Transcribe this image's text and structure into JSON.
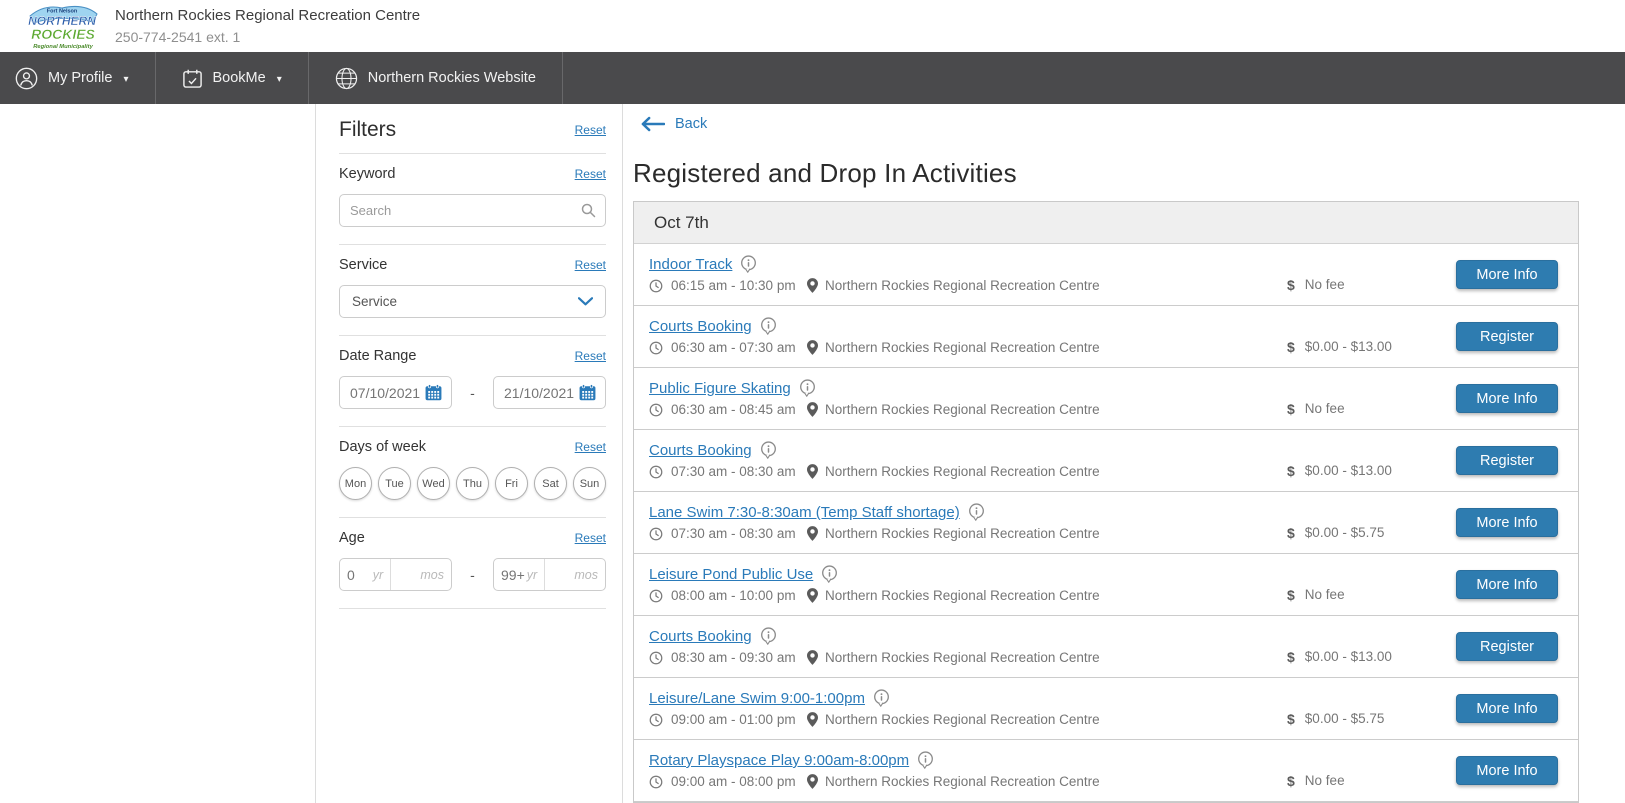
{
  "header": {
    "title": "Northern Rockies Regional Recreation Centre",
    "phone": "250-774-2541 ext. 1",
    "logo": {
      "top": "Fort Nelson",
      "line1": "NORTHERN",
      "line2": "ROCKIES",
      "bottom": "Regional Municipality"
    }
  },
  "nav": {
    "dropdown_caret": "▾",
    "items": [
      {
        "label": "My Profile",
        "icon": "person-icon",
        "has_dropdown": true
      },
      {
        "label": "BookMe",
        "icon": "calendar-check-icon",
        "has_dropdown": true
      },
      {
        "label": "Northern Rockies Website",
        "icon": "globe-icon",
        "has_dropdown": false
      }
    ]
  },
  "filters": {
    "title": "Filters",
    "reset_label": "Reset",
    "keyword": {
      "label": "Keyword",
      "placeholder": "Search"
    },
    "service": {
      "label": "Service",
      "selected_value": "Service"
    },
    "date_range": {
      "label": "Date Range",
      "from": "07/10/2021",
      "to": "21/10/2021",
      "separator": "-"
    },
    "days_of_week": {
      "label": "Days of week",
      "days": [
        "Mon",
        "Tue",
        "Wed",
        "Thu",
        "Fri",
        "Sat",
        "Sun"
      ]
    },
    "age": {
      "label": "Age",
      "separator": "-",
      "from": {
        "value": "0",
        "unit": "yr",
        "months_placeholder": "mos"
      },
      "to": {
        "value": "99+",
        "unit": "yr",
        "months_placeholder": "mos"
      }
    }
  },
  "main": {
    "back_label": "Back",
    "page_title": "Registered and Drop In Activities",
    "date_header": "Oct 7th",
    "fee_symbol": "$",
    "activities": [
      {
        "title": "Indoor Track",
        "time": "06:15 am - 10:30 pm",
        "location": "Northern Rockies Regional Recreation Centre",
        "fee": "No fee",
        "action": "More Info"
      },
      {
        "title": "Courts Booking",
        "time": "06:30 am - 07:30 am",
        "location": "Northern Rockies Regional Recreation Centre",
        "fee": "$0.00 - $13.00",
        "action": "Register"
      },
      {
        "title": "Public Figure Skating",
        "time": "06:30 am - 08:45 am",
        "location": "Northern Rockies Regional Recreation Centre",
        "fee": "No fee",
        "action": "More Info"
      },
      {
        "title": "Courts Booking",
        "time": "07:30 am - 08:30 am",
        "location": "Northern Rockies Regional Recreation Centre",
        "fee": "$0.00 - $13.00",
        "action": "Register"
      },
      {
        "title": "Lane Swim 7:30-8:30am (Temp Staff shortage)",
        "time": "07:30 am - 08:30 am",
        "location": "Northern Rockies Regional Recreation Centre",
        "fee": "$0.00 - $5.75",
        "action": "More Info"
      },
      {
        "title": "Leisure Pond Public Use",
        "time": "08:00 am - 10:00 pm",
        "location": "Northern Rockies Regional Recreation Centre",
        "fee": "No fee",
        "action": "More Info"
      },
      {
        "title": "Courts Booking",
        "time": "08:30 am - 09:30 am",
        "location": "Northern Rockies Regional Recreation Centre",
        "fee": "$0.00 - $13.00",
        "action": "Register"
      },
      {
        "title": "Leisure/Lane Swim 9:00-1:00pm",
        "time": "09:00 am - 01:00 pm",
        "location": "Northern Rockies Regional Recreation Centre",
        "fee": "$0.00 - $5.75",
        "action": "More Info"
      },
      {
        "title": "Rotary Playspace Play 9:00am-8:00pm",
        "time": "09:00 am - 08:00 pm",
        "location": "Northern Rockies Regional Recreation Centre",
        "fee": "No fee",
        "action": "More Info"
      }
    ]
  },
  "colors": {
    "accent_blue": "#2e7cb0",
    "link_blue": "#2a7ab9",
    "nav_background": "#4a4a4c",
    "muted_text": "#767676",
    "header_bar_gray": "#efefef"
  }
}
